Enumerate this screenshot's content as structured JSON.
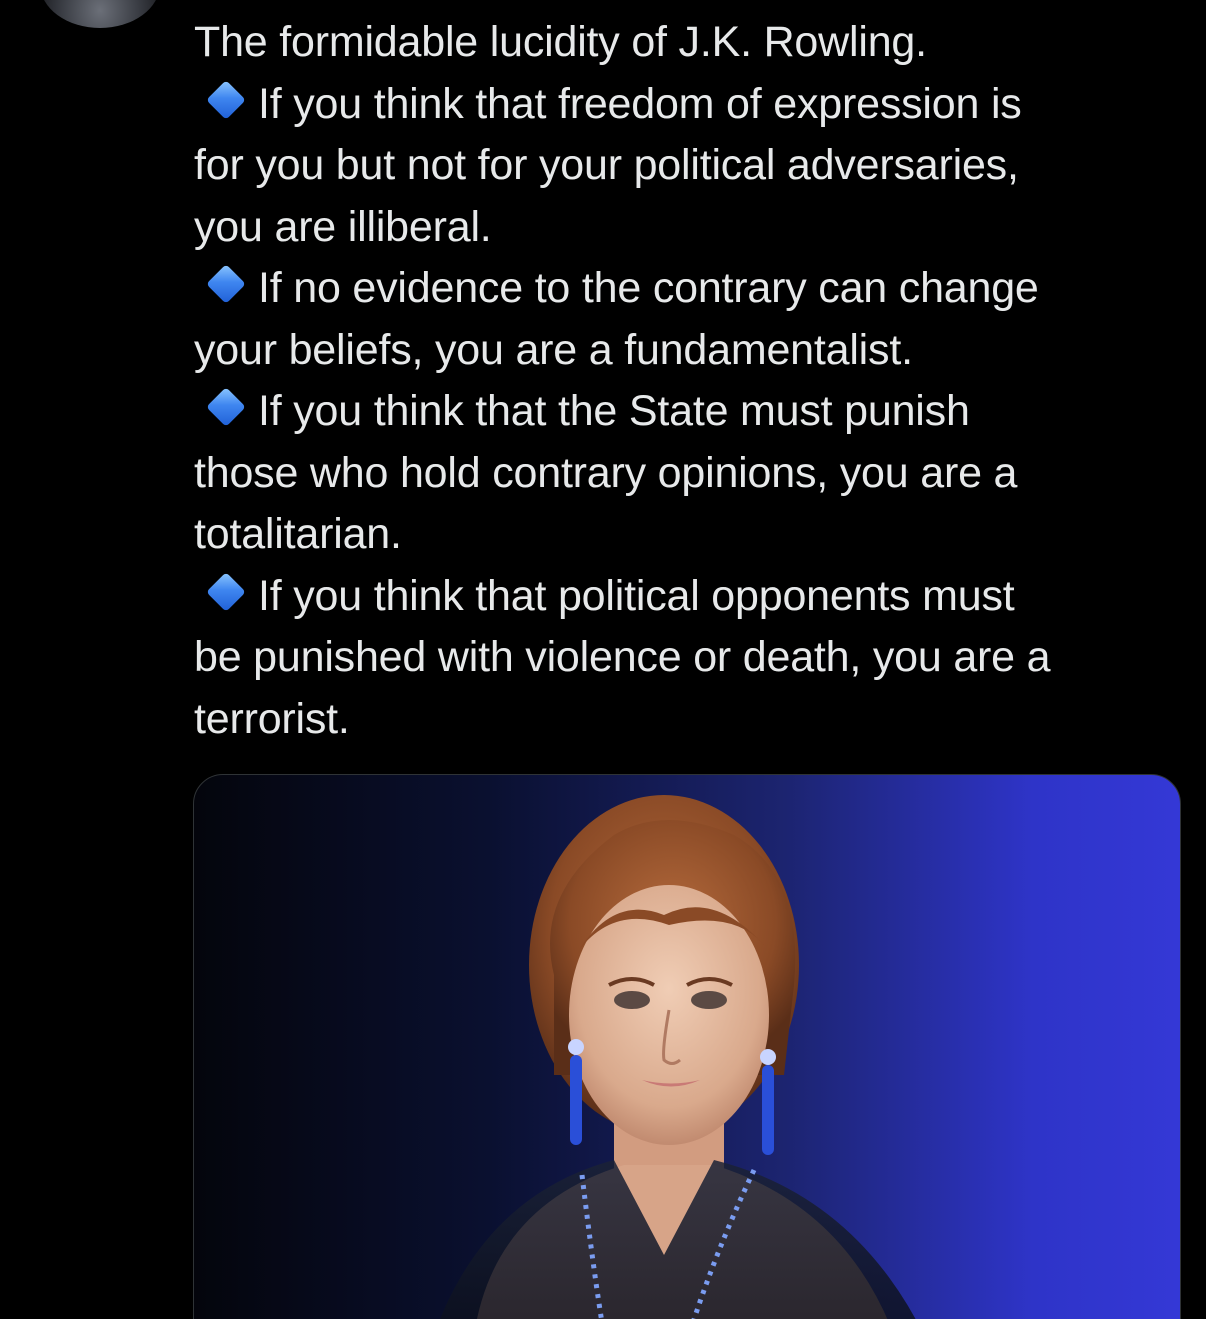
{
  "tweet": {
    "lines": [
      "The formidable lucidity of J.K. Rowling.",
      "If you think that freedom of expression is",
      "for you but not for your political adversaries,",
      "you are illiberal.",
      "If no evidence to the contrary can change",
      "your beliefs, you are a fundamentalist.",
      "If you think that the State must punish",
      "those who hold contrary opinions, you are a",
      "totalitarian.",
      "If you think that political opponents must",
      "be punished with violence or death, you are a",
      "terrorist."
    ],
    "bullet_icon": "small-blue-diamond",
    "bullet_color": "#3f86f0",
    "text_color": "#e7e9ea",
    "background": "#000000"
  },
  "media": {
    "type": "photo",
    "accent_color": "#3438d6"
  }
}
